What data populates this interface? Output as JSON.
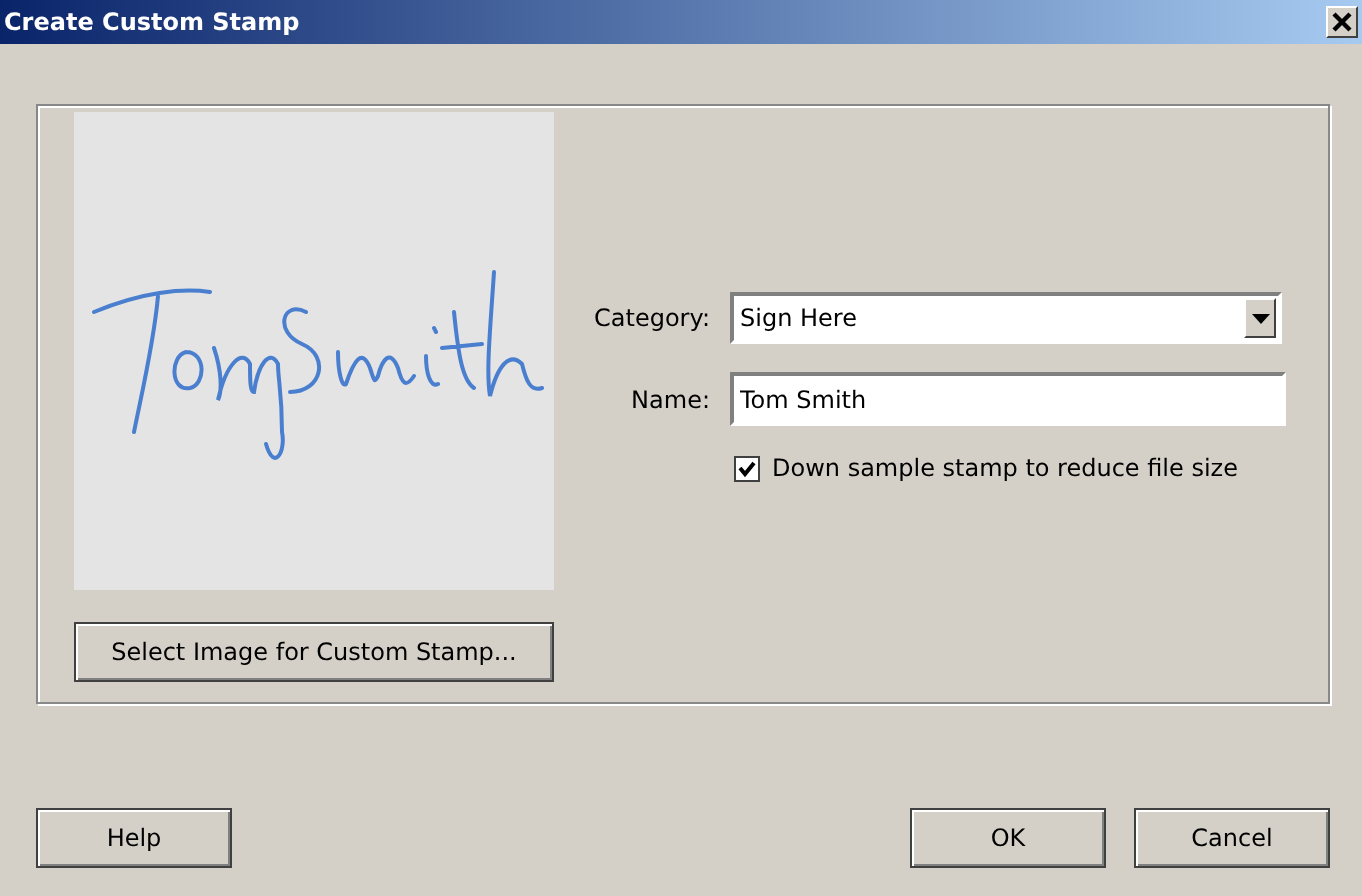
{
  "window": {
    "title": "Create Custom Stamp"
  },
  "preview": {
    "button": "Select Image for Custom Stamp..."
  },
  "form": {
    "category": {
      "label": "Category:",
      "value": "Sign Here"
    },
    "name": {
      "label": "Name:",
      "value": "Tom Smith"
    },
    "downsample": {
      "label": "Down sample stamp to reduce file size",
      "checked": true
    }
  },
  "buttons": [
    {
      "label": "Help",
      "kind": "left"
    },
    {
      "label": "OK",
      "kind": "right"
    },
    {
      "label": "Cancel",
      "kind": "right"
    }
  ]
}
